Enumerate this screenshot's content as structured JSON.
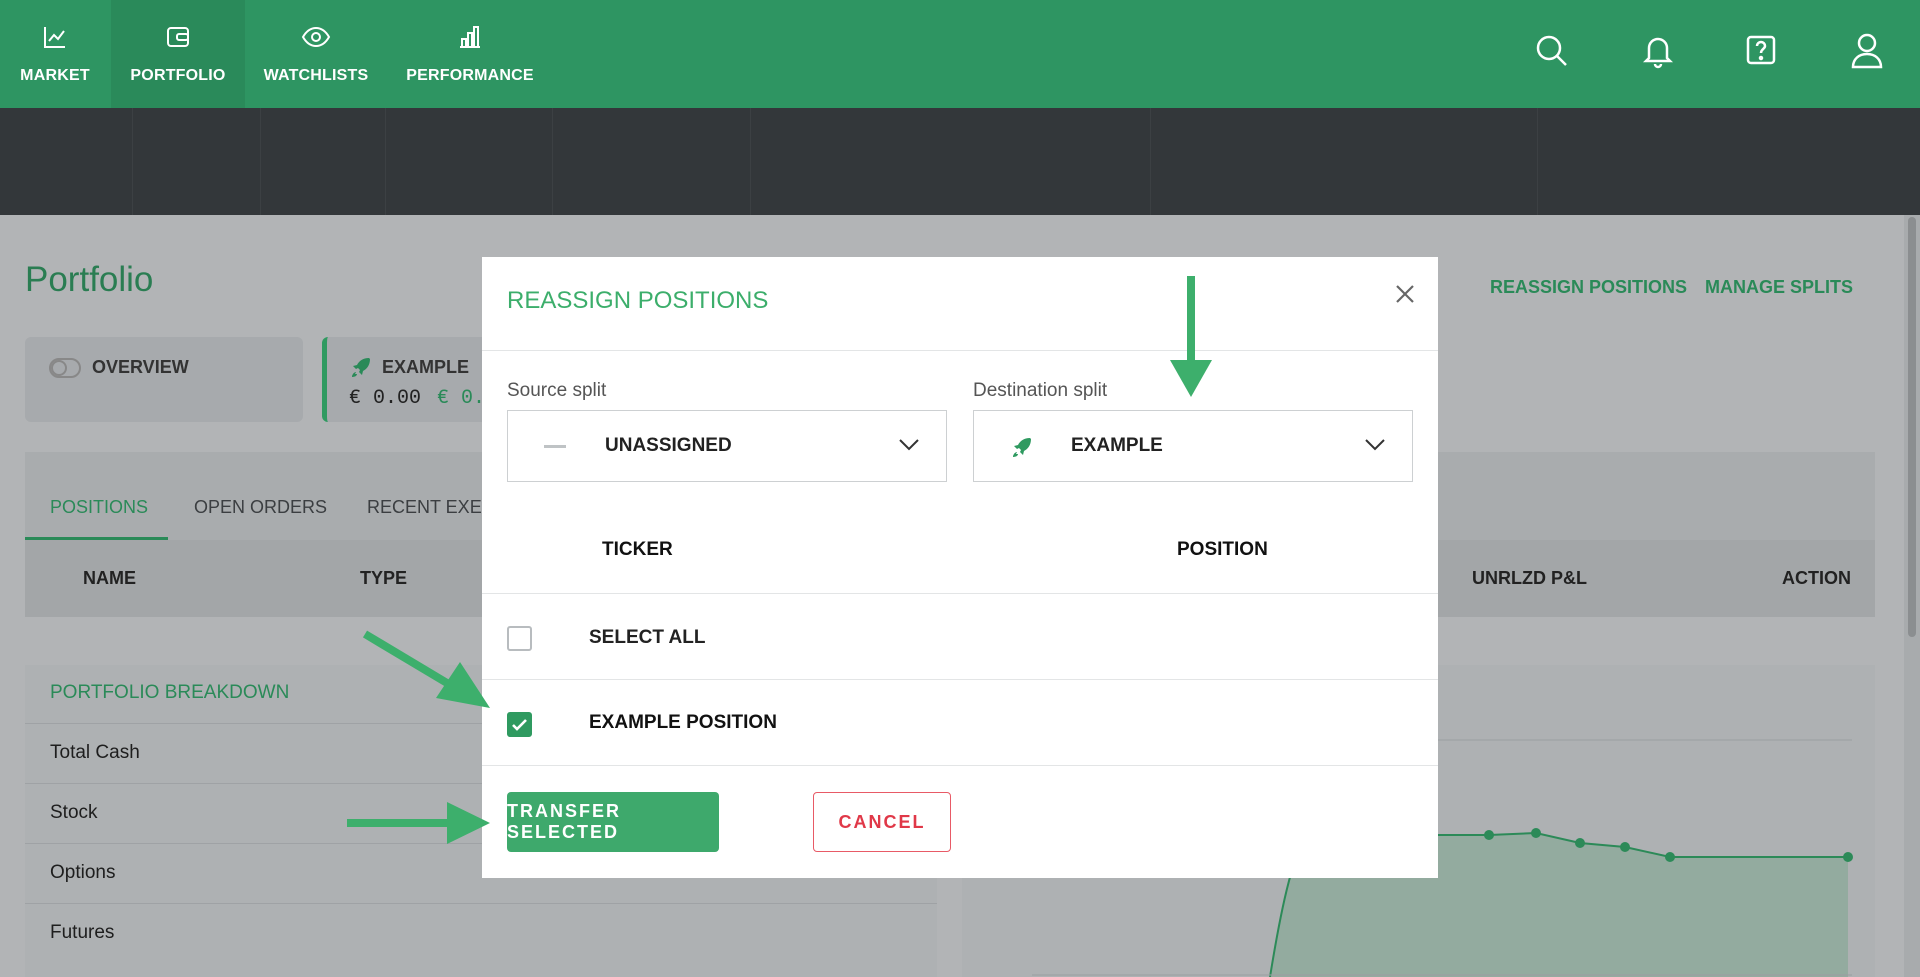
{
  "nav": {
    "items": [
      {
        "label": "MARKET",
        "icon": "line-chart-icon"
      },
      {
        "label": "PORTFOLIO",
        "icon": "wallet-icon"
      },
      {
        "label": "WATCHLISTS",
        "icon": "eye-icon"
      },
      {
        "label": "PERFORMANCE",
        "icon": "bar-chart-icon"
      }
    ],
    "active": "PORTFOLIO",
    "right_icons": [
      "search-icon",
      "bell-icon",
      "help-icon",
      "user-icon"
    ]
  },
  "page": {
    "title": "Portfolio",
    "links": [
      "REASSIGN POSITIONS",
      "MANAGE SPLITS"
    ],
    "cards": [
      {
        "title": "OVERVIEW"
      },
      {
        "title": "EXAMPLE",
        "value": "€ 0.00",
        "change": "€ 0."
      }
    ],
    "tabs": [
      "POSITIONS",
      "OPEN ORDERS",
      "RECENT EXEC"
    ],
    "table_headers": [
      "NAME",
      "TYPE",
      "UNRLZD P&L",
      "ACTION"
    ],
    "breakdown": {
      "title": "PORTFOLIO BREAKDOWN",
      "rows": [
        "Total Cash",
        "Stock",
        "Options",
        "Futures"
      ]
    }
  },
  "modal": {
    "title": "REASSIGN POSITIONS",
    "source_label": "Source split",
    "source_value": "UNASSIGNED",
    "destination_label": "Destination split",
    "destination_value": "EXAMPLE",
    "columns": [
      "TICKER",
      "POSITION"
    ],
    "select_all": "SELECT ALL",
    "select_all_checked": false,
    "rows": [
      {
        "label": "EXAMPLE POSITION",
        "checked": true
      }
    ],
    "transfer_label": "TRANSFER SELECTED",
    "cancel_label": "CANCEL"
  },
  "colors": {
    "brand_green": "#2e9562",
    "dark_bar": "#33373a",
    "accent_green": "#3ea96c",
    "cancel_red": "#e03848",
    "arrow_green": "#3daf6c"
  }
}
